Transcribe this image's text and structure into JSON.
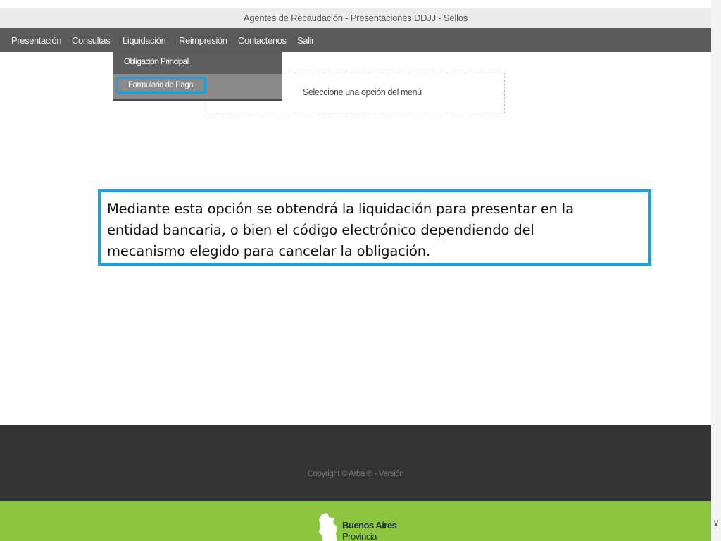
{
  "window": {
    "title": "Agentes de Recaudación - Presentaciones DDJJ - Sellos"
  },
  "menu": {
    "items": [
      {
        "label": "Presentación"
      },
      {
        "label": "Consultas"
      },
      {
        "label": "Liquidación"
      },
      {
        "label": "Reimpresión"
      },
      {
        "label": "Contactenos"
      },
      {
        "label": "Salir"
      }
    ],
    "dropdown": {
      "items": [
        {
          "label": "Obligación Principal"
        },
        {
          "label": "Formulario de Pago",
          "highlighted": true
        }
      ]
    }
  },
  "main": {
    "select_prompt": "Seleccione una opción del menú"
  },
  "callout": {
    "lines": [
      "Mediante esta opción se obtendrá la liquidación para presentar en la",
      "entidad bancaria, o bien el código electrónico dependiendo del",
      "mecanismo elegido para cancelar la obligación."
    ],
    "border_color": "#1aa0dc"
  },
  "footer": {
    "copyright": "Copyright © Arba ® - Versión",
    "logo": {
      "line1": "Buenos Aires",
      "line2": "Provincia"
    },
    "green_color": "#8cc63f",
    "dark_color": "#333333"
  },
  "scroll": {
    "icon": "chevron-down-icon"
  }
}
